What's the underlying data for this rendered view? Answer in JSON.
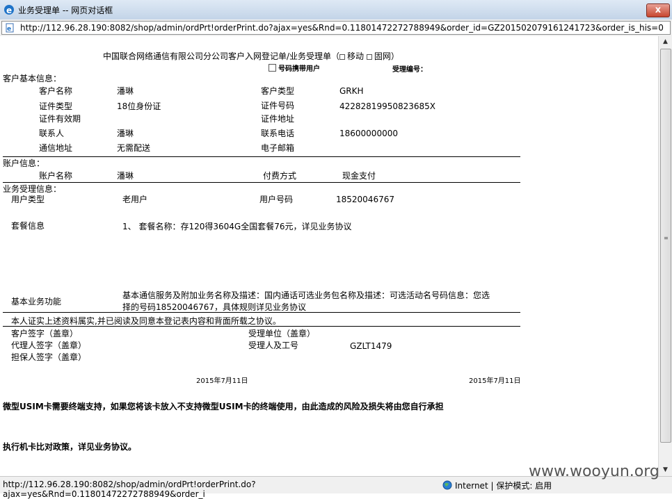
{
  "window": {
    "title": "业务受理单 -- 网页对话框",
    "close_label": "x",
    "url": "http://112.96.28.190:8082/shop/admin/ordPrt!orderPrint.do?ajax=yes&Rnd=0.11801472272788949&order_id=GZ201502079161241723&order_is_his=0"
  },
  "form": {
    "header_title": "中国联合网络通信有限公司分公司客户入网登记单/业务受理单（",
    "opt_mobile": "移动",
    "opt_fixed": "固网）",
    "portable_label": "号码携带用户",
    "receipt_no_label": "受理编号：",
    "section_customer": "客户基本信息：",
    "customer": {
      "name_label": "客户名称",
      "name_value": "潘琳",
      "type_label": "客户类型",
      "type_value": "GRKH",
      "id_type_label": "证件类型",
      "id_type_value": "18位身份证",
      "id_no_label": "证件号码",
      "id_no_value": "42282819950823685X",
      "id_valid_label": "证件有效期",
      "id_addr_label": "证件地址",
      "contact_label": "联系人",
      "contact_value": "潘琳",
      "phone_label": "联系电话",
      "phone_value": "18600000000",
      "mail_addr_label": "通信地址",
      "mail_addr_value": "无需配送",
      "email_label": "电子邮箱"
    },
    "section_account": "账户信息：",
    "account": {
      "name_label": "账户名称",
      "name_value": "潘琳",
      "pay_label": "付费方式",
      "pay_value": "现金支付"
    },
    "section_business": "业务受理信息：",
    "business": {
      "user_type_label": "用户类型",
      "user_type_value": "老用户",
      "user_no_label": "用户号码",
      "user_no_value": "18520046767",
      "package_label": "套餐信息",
      "package_value": "1、 套餐名称：存120得3604G全国套餐76元，详见业务协议",
      "basic_label": "基本业务功能",
      "basic_value_line1": "基本通信服务及附加业务名称及描述：国内通话可选业务包名称及描述：可选活动名号码信息：您选",
      "basic_value_line2": "择的号码18520046767，具体规则详见业务协议"
    },
    "declaration": "本人证实上述资料属实,并已阅读及同意本登记表内容和背面所载之协议。",
    "sign": {
      "customer_sign": "客户签字（盖章）",
      "agent_sign": "代理人签字（盖章）",
      "guarantor_sign": "担保人签字（盖章）",
      "unit_seal": "受理单位（盖章）",
      "operator_label": "受理人及工号",
      "operator_value": "GZLT1479",
      "date_left": "2015年7月11日",
      "date_right": "2015年7月11日"
    },
    "notice_usim": "微型USIM卡需要终端支持，如果您将该卡放入不支持微型USIM卡的终端使用，由此造成的风险及损失将由您自行承担",
    "notice_policy": "执行机卡比对政策，详见业务协议。"
  },
  "statusbar": {
    "url": "http://112.96.28.190:8082/shop/admin/ordPrt!orderPrint.do?ajax=yes&Rnd=0.11801472272788949&order_i",
    "zone": "Internet | 保护模式: 启用"
  },
  "watermark": "www.wooyun.org"
}
